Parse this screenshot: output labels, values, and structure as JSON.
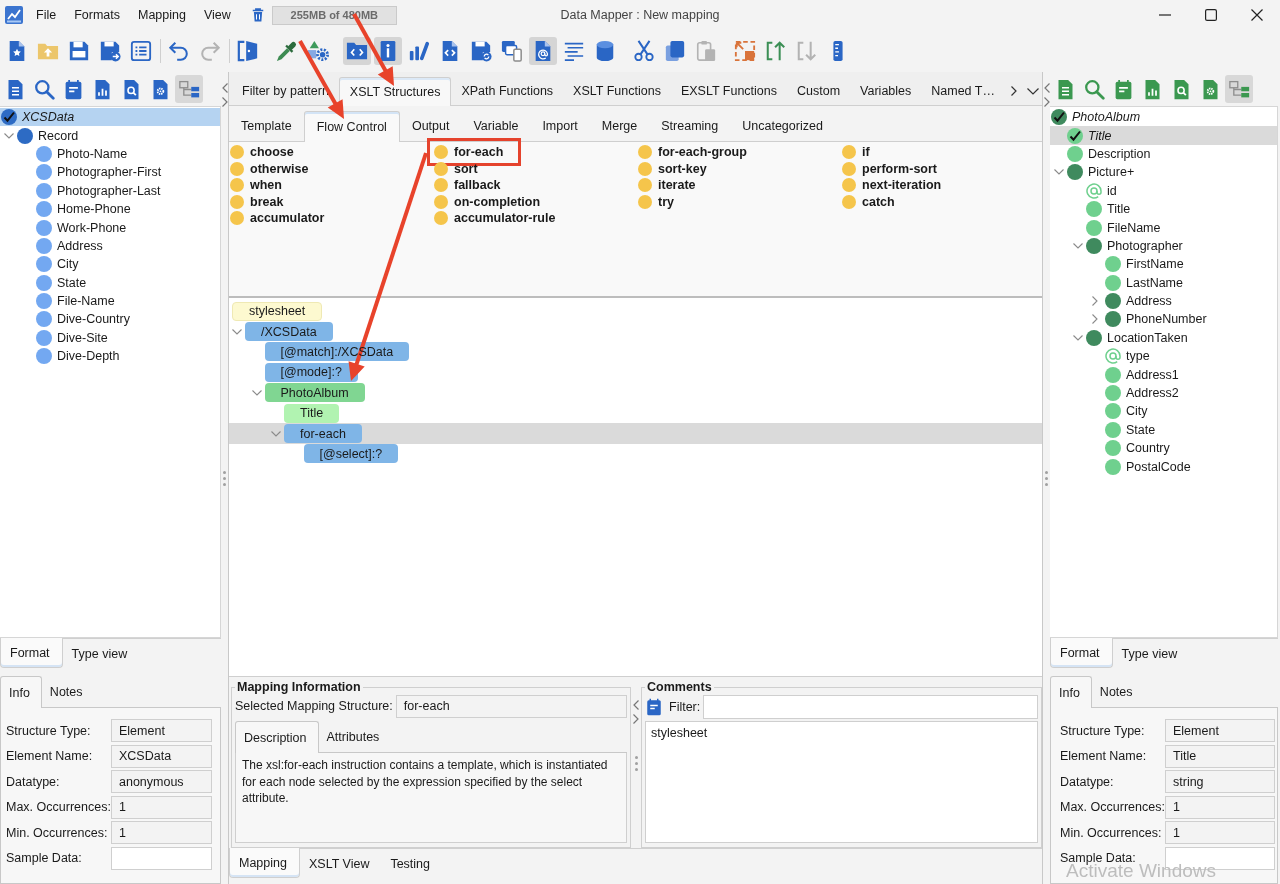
{
  "window": {
    "title": "Data Mapper : New mapping"
  },
  "menu": [
    "File",
    "Formats",
    "Mapping",
    "View"
  ],
  "memory_usage": "255MB of 480MB",
  "toolbar": {
    "groups": [
      {
        "divider": false,
        "buttons": [
          {
            "pressed": false,
            "disabled": false
          },
          {
            "pressed": false,
            "disabled": false
          },
          {
            "pressed": false,
            "disabled": false
          },
          {
            "pressed": false,
            "disabled": false
          },
          {
            "pressed": false,
            "disabled": false
          }
        ]
      },
      {
        "divider": true,
        "buttons": [
          {
            "pressed": false,
            "disabled": false
          },
          {
            "pressed": false,
            "disabled": true
          }
        ]
      },
      {
        "divider": true,
        "buttons": [
          {
            "pressed": false,
            "disabled": false
          }
        ]
      },
      {
        "divider": false,
        "buttons": [
          {
            "pressed": false,
            "disabled": false
          },
          {
            "pressed": false,
            "disabled": false
          }
        ]
      },
      {
        "divider": false,
        "buttons": [
          {
            "pressed": true,
            "disabled": false
          },
          {
            "pressed": true,
            "disabled": false
          },
          {
            "pressed": false,
            "disabled": false
          },
          {
            "pressed": false,
            "disabled": false
          },
          {
            "pressed": false,
            "disabled": false
          },
          {
            "pressed": false,
            "disabled": false
          },
          {
            "pressed": true,
            "disabled": false
          },
          {
            "pressed": false,
            "disabled": false
          },
          {
            "pressed": false,
            "disabled": false
          }
        ]
      },
      {
        "divider": false,
        "buttons": [
          {
            "pressed": false,
            "disabled": false
          },
          {
            "pressed": false,
            "disabled": false
          },
          {
            "pressed": false,
            "disabled": true
          }
        ]
      },
      {
        "divider": false,
        "buttons": [
          {
            "pressed": false,
            "disabled": false
          },
          {
            "pressed": false,
            "disabled": false
          },
          {
            "pressed": false,
            "disabled": true
          },
          {
            "pressed": false,
            "disabled": false
          }
        ]
      }
    ]
  },
  "left_panel": {
    "toolbar": [
      {
        "pressed": false
      },
      {
        "pressed": false
      },
      {
        "pressed": false
      },
      {
        "pressed": false
      },
      {
        "pressed": false
      },
      {
        "pressed": false
      },
      {
        "pressed": true
      }
    ],
    "tree": [
      {
        "label": "XCSData",
        "kind": "group",
        "checked": true,
        "selected": true,
        "children": [
          {
            "label": "Record",
            "kind": "group",
            "checked": false,
            "selected": false,
            "expanded": true,
            "children": [
              {
                "label": "Photo-Name",
                "kind": "leaf",
                "checked": false,
                "selected": false
              },
              {
                "label": "Photographer-First",
                "kind": "leaf",
                "checked": false,
                "selected": false
              },
              {
                "label": "Photographer-Last",
                "kind": "leaf",
                "checked": false,
                "selected": false
              },
              {
                "label": "Home-Phone",
                "kind": "leaf",
                "checked": false,
                "selected": false
              },
              {
                "label": "Work-Phone",
                "kind": "leaf",
                "checked": false,
                "selected": false
              },
              {
                "label": "Address",
                "kind": "leaf",
                "checked": false,
                "selected": false
              },
              {
                "label": "City",
                "kind": "leaf",
                "checked": false,
                "selected": false
              },
              {
                "label": "State",
                "kind": "leaf",
                "checked": false,
                "selected": false
              },
              {
                "label": "File-Name",
                "kind": "leaf",
                "checked": false,
                "selected": false
              },
              {
                "label": "Dive-Country",
                "kind": "leaf",
                "checked": false,
                "selected": false
              },
              {
                "label": "Dive-Site",
                "kind": "leaf",
                "checked": false,
                "selected": false
              },
              {
                "label": "Dive-Depth",
                "kind": "leaf",
                "checked": false,
                "selected": false
              }
            ]
          }
        ]
      }
    ],
    "view_tabs": [
      {
        "label": "Format",
        "selected": true
      },
      {
        "label": "Type view",
        "selected": false
      }
    ],
    "info_tabs": [
      {
        "label": "Info",
        "selected": true
      },
      {
        "label": "Notes",
        "selected": false
      }
    ],
    "fields": [
      {
        "label": "Structure Type:",
        "value": "Element",
        "readonly": true
      },
      {
        "label": "Element Name:",
        "value": "XCSData",
        "readonly": true
      },
      {
        "label": "Datatype:",
        "value": "anonymous",
        "readonly": true
      },
      {
        "label": "Max. Occurrences:",
        "value": "1",
        "readonly": true
      },
      {
        "label": "Min. Occurrences:",
        "value": "1",
        "readonly": true
      },
      {
        "label": "Sample Data:",
        "readonly": false
      }
    ]
  },
  "center": {
    "category_tabs": [
      {
        "label": "Filter by pattern",
        "selected": false
      },
      {
        "label": "XSLT Structures",
        "selected": true
      },
      {
        "label": "XPath Functions",
        "selected": false
      },
      {
        "label": "XSLT Functions",
        "selected": false
      },
      {
        "label": "EXSLT Functions",
        "selected": false
      },
      {
        "label": "Custom",
        "selected": false
      },
      {
        "label": "Variables",
        "selected": false
      },
      {
        "label": "Named T…",
        "selected": false
      }
    ],
    "group_tabs": [
      {
        "label": "Template",
        "selected": false
      },
      {
        "label": "Flow Control",
        "selected": true
      },
      {
        "label": "Output",
        "selected": false
      },
      {
        "label": "Variable",
        "selected": false
      },
      {
        "label": "Import",
        "selected": false
      },
      {
        "label": "Merge",
        "selected": false
      },
      {
        "label": "Streaming",
        "selected": false
      },
      {
        "label": "Uncategorized",
        "selected": false
      }
    ],
    "palette": [
      [
        {
          "label": "choose",
          "highlighted": false
        },
        {
          "label": "otherwise",
          "highlighted": false
        },
        {
          "label": "when",
          "highlighted": false
        },
        {
          "label": "break",
          "highlighted": false
        },
        {
          "label": "accumulator",
          "highlighted": false
        }
      ],
      [
        {
          "label": "for-each",
          "highlighted": true
        },
        {
          "label": "sort",
          "highlighted": false
        },
        {
          "label": "fallback",
          "highlighted": false
        },
        {
          "label": "on-completion",
          "highlighted": false
        },
        {
          "label": "accumulator-rule",
          "highlighted": false
        }
      ],
      [
        {
          "label": "for-each-group",
          "highlighted": false
        },
        {
          "label": "sort-key",
          "highlighted": false
        },
        {
          "label": "iterate",
          "highlighted": false
        },
        {
          "label": "try",
          "highlighted": false
        }
      ],
      [
        {
          "label": "if",
          "highlighted": false
        },
        {
          "label": "perform-sort",
          "highlighted": false
        },
        {
          "label": "next-iteration",
          "highlighted": false
        },
        {
          "label": "catch",
          "highlighted": false
        }
      ]
    ],
    "mapping_tree": [
      {
        "label": "stylesheet",
        "kind": "stylesheet",
        "selected": false,
        "children": [
          {
            "label": "/XCSData",
            "kind": "xslt",
            "selected": false,
            "expanded": true,
            "children": [
              {
                "label": "[@match]:/XCSData",
                "kind": "xslt",
                "selected": false
              },
              {
                "label": "[@mode]:?",
                "kind": "xslt",
                "selected": false
              },
              {
                "label": "PhotoAlbum",
                "kind": "element",
                "selected": false,
                "expanded": true,
                "children": [
                  {
                    "label": "Title",
                    "kind": "leaf",
                    "selected": false
                  },
                  {
                    "label": "for-each",
                    "kind": "xslt",
                    "selected": true,
                    "expanded": true,
                    "children": [
                      {
                        "label": "[@select]:?",
                        "kind": "xslt",
                        "selected": false
                      }
                    ]
                  }
                ]
              }
            ]
          }
        ]
      }
    ],
    "mapping_information": {
      "title": "Mapping Information",
      "selected_field": {
        "label": "Selected Mapping Structure:",
        "value": "for-each",
        "readonly": true
      },
      "tabs": [
        {
          "label": "Description",
          "selected": true
        },
        {
          "label": "Attributes",
          "selected": false
        }
      ],
      "description": "The xsl:for-each instruction contains a template, which is instantiated for each node selected by the expression specified by the select attribute."
    },
    "comments": {
      "title": "Comments",
      "filter_label": "Filter:",
      "items": [
        "stylesheet"
      ]
    },
    "view_tabs": [
      {
        "label": "Mapping",
        "selected": true
      },
      {
        "label": "XSLT View",
        "selected": false
      },
      {
        "label": "Testing",
        "selected": false
      }
    ]
  },
  "right_panel": {
    "toolbar": [
      {
        "pressed": false
      },
      {
        "pressed": false
      },
      {
        "pressed": false
      },
      {
        "pressed": false
      },
      {
        "pressed": false
      },
      {
        "pressed": false
      },
      {
        "pressed": true
      }
    ],
    "tree": [
      {
        "label": "PhotoAlbum",
        "kind": "group",
        "checked": true,
        "selected": false,
        "children": [
          {
            "label": "Title",
            "kind": "leaf",
            "checked": true,
            "selected": true
          },
          {
            "label": "Description",
            "kind": "leaf",
            "checked": false,
            "selected": false
          },
          {
            "label": "Picture+",
            "kind": "group",
            "checked": false,
            "selected": false,
            "expanded": true,
            "children": [
              {
                "label": "id",
                "kind": "attribute",
                "checked": false,
                "selected": false
              },
              {
                "label": "Title",
                "kind": "leaf",
                "checked": false,
                "selected": false
              },
              {
                "label": "FileName",
                "kind": "leaf",
                "checked": false,
                "selected": false
              },
              {
                "label": "Photographer",
                "kind": "group",
                "checked": false,
                "selected": false,
                "expanded": true,
                "children": [
                  {
                    "label": "FirstName",
                    "kind": "leaf",
                    "checked": false,
                    "selected": false
                  },
                  {
                    "label": "LastName",
                    "kind": "leaf",
                    "checked": false,
                    "selected": false
                  },
                  {
                    "label": "Address",
                    "kind": "group",
                    "checked": false,
                    "selected": false,
                    "expanded": false
                  },
                  {
                    "label": "PhoneNumber",
                    "kind": "group",
                    "checked": false,
                    "selected": false,
                    "expanded": false
                  }
                ]
              },
              {
                "label": "LocationTaken",
                "kind": "group",
                "checked": false,
                "selected": false,
                "expanded": true,
                "children": [
                  {
                    "label": "type",
                    "kind": "attribute",
                    "checked": false,
                    "selected": false
                  },
                  {
                    "label": "Address1",
                    "kind": "leaf",
                    "checked": false,
                    "selected": false
                  },
                  {
                    "label": "Address2",
                    "kind": "leaf",
                    "checked": false,
                    "selected": false
                  },
                  {
                    "label": "City",
                    "kind": "leaf",
                    "checked": false,
                    "selected": false
                  },
                  {
                    "label": "State",
                    "kind": "leaf",
                    "checked": false,
                    "selected": false
                  },
                  {
                    "label": "Country",
                    "kind": "leaf",
                    "checked": false,
                    "selected": false
                  },
                  {
                    "label": "PostalCode",
                    "kind": "leaf",
                    "checked": false,
                    "selected": false
                  }
                ]
              }
            ]
          }
        ]
      }
    ],
    "view_tabs": [
      {
        "label": "Format",
        "selected": true
      },
      {
        "label": "Type view",
        "selected": false
      }
    ],
    "info_tabs": [
      {
        "label": "Info",
        "selected": true
      },
      {
        "label": "Notes",
        "selected": false
      }
    ],
    "fields": [
      {
        "label": "Structure Type:",
        "value": "Element",
        "readonly": true
      },
      {
        "label": "Element Name:",
        "value": "Title",
        "readonly": true
      },
      {
        "label": "Datatype:",
        "value": "string",
        "readonly": true
      },
      {
        "label": "Max. Occurrences:",
        "value": "1",
        "readonly": true
      },
      {
        "label": "Min. Occurrences:",
        "value": "1",
        "readonly": true
      },
      {
        "label": "Sample Data:",
        "readonly": false
      }
    ]
  },
  "annotations": [
    {
      "kind": "arrow"
    },
    {
      "kind": "arrow"
    },
    {
      "kind": "arrow"
    }
  ],
  "activation_notice": "Activate Windows"
}
